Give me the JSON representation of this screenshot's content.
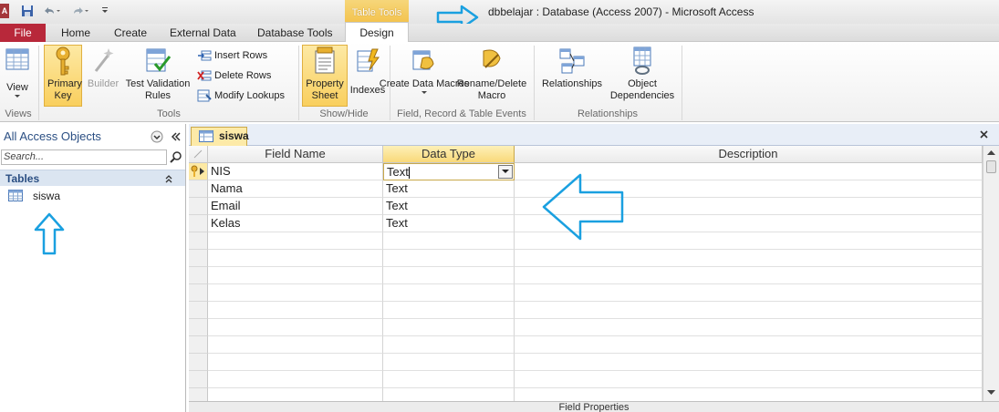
{
  "window": {
    "title": "dbbelajar : Database (Access 2007)  -  Microsoft Access",
    "app_icon": "A",
    "contextual_tab": "Table Tools"
  },
  "tabs": [
    {
      "label": "File"
    },
    {
      "label": "Home"
    },
    {
      "label": "Create"
    },
    {
      "label": "External Data"
    },
    {
      "label": "Database Tools"
    },
    {
      "label": "Design"
    }
  ],
  "ribbon": {
    "views": {
      "label": "Views",
      "view_label": "View"
    },
    "tools": {
      "label": "Tools",
      "primary_key": "Primary Key",
      "builder": "Builder",
      "test_validation": "Test Validation Rules",
      "insert_rows": "Insert Rows",
      "delete_rows": "Delete Rows",
      "modify_lookups": "Modify Lookups"
    },
    "showhide": {
      "label": "Show/Hide",
      "property_sheet": "Property Sheet",
      "indexes": "Indexes"
    },
    "events": {
      "label": "Field, Record & Table Events",
      "create_data_macros": "Create Data Macros",
      "rename_delete_macro": "Rename/Delete Macro"
    },
    "relationships": {
      "label": "Relationships",
      "relationships_btn": "Relationships",
      "object_dependencies": "Object Dependencies"
    }
  },
  "nav": {
    "title": "All Access Objects",
    "search_placeholder": "Search...",
    "category": "Tables",
    "items": [
      {
        "label": "siswa"
      }
    ]
  },
  "document": {
    "tab_label": "siswa",
    "columns": [
      "Field Name",
      "Data Type",
      "Description"
    ],
    "rows": [
      {
        "field": "NIS",
        "type": "Text",
        "description": ""
      },
      {
        "field": "Nama",
        "type": "Text",
        "description": ""
      },
      {
        "field": "Email",
        "type": "Text",
        "description": ""
      },
      {
        "field": "Kelas",
        "type": "Text",
        "description": ""
      }
    ],
    "field_properties": "Field Properties"
  },
  "colors": {
    "accent_arrow": "#1aa0e0",
    "file_tab": "#b8283a",
    "highlight": "#f9cf5e"
  }
}
